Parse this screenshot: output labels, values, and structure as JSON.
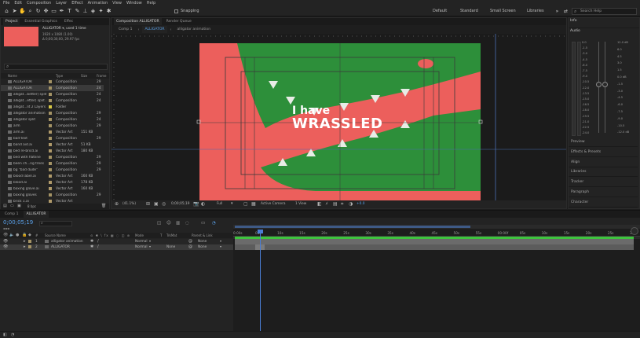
{
  "menu": [
    "File",
    "Edit",
    "Composition",
    "Layer",
    "Effect",
    "Animation",
    "View",
    "Window",
    "Help"
  ],
  "toolbar": {
    "snapping_label": "Snapping",
    "workspaces": [
      "Default",
      "Standard",
      "Small Screen",
      "Libraries"
    ],
    "search_placeholder": "Search Help"
  },
  "project_panel": {
    "tabs": [
      "Project",
      "Essential Graphics",
      "Effec"
    ],
    "selected_name": "ALLIGATOR ▾, used 1 time",
    "selected_info1": "1920 x 1080 (1.00)",
    "selected_info2": "Δ 0;00;30;00, 29.97 fps",
    "columns": {
      "name": "Name",
      "type": "Type",
      "size": "Size",
      "frame": "Frame"
    },
    "rows": [
      {
        "name": "ALLIGATOR",
        "type": "Composition",
        "size": "",
        "frame": "29",
        "label": "#a49365"
      },
      {
        "name": "ALLIGATOR",
        "type": "Composition",
        "size": "",
        "frame": "24",
        "label": "#a49365",
        "selected": true
      },
      {
        "name": "alligat...better) split",
        "type": "Composition",
        "size": "",
        "frame": "24",
        "label": "#a49365"
      },
      {
        "name": "alligat...etter) split 2",
        "type": "Composition",
        "size": "",
        "frame": "24",
        "label": "#a49365"
      },
      {
        "name": "alligat...lit 2 Layers",
        "type": "Folder",
        "size": "",
        "frame": "",
        "label": "#d8c845"
      },
      {
        "name": "alligator animation",
        "type": "Composition",
        "size": "",
        "frame": "29",
        "label": "#a49365"
      },
      {
        "name": "alligator split",
        "type": "Composition",
        "size": "",
        "frame": "24",
        "label": "#a49365"
      },
      {
        "name": "arm",
        "type": "Composition",
        "size": "",
        "frame": "29",
        "label": "#a49365"
      },
      {
        "name": "arm.ai",
        "type": "Vector Art",
        "size": "151 KB",
        "frame": "",
        "label": "#b09a6a"
      },
      {
        "name": "bad text",
        "type": "Composition",
        "size": "",
        "frame": "29",
        "label": "#a49365"
      },
      {
        "name": "band aid.ai",
        "type": "Vector Art",
        "size": "51 KB",
        "frame": "",
        "label": "#b09a6a"
      },
      {
        "name": "bed re-bricd.ai",
        "type": "Vector Art",
        "size": "180 KB",
        "frame": "",
        "label": "#b09a6a"
      },
      {
        "name": "bed with flatline",
        "type": "Composition",
        "size": "",
        "frame": "29",
        "label": "#a49365"
      },
      {
        "name": "been ch...ng trees",
        "type": "Composition",
        "size": "",
        "frame": "29",
        "label": "#a49365"
      },
      {
        "name": "bg \"bad dude\"",
        "type": "Composition",
        "size": "",
        "frame": "29",
        "label": "#a49365"
      },
      {
        "name": "blood label.ai",
        "type": "Vector Art",
        "size": "160 KB",
        "frame": "",
        "label": "#b09a6a"
      },
      {
        "name": "blood.ai",
        "type": "Vector Art",
        "size": "178 KB",
        "frame": "",
        "label": "#b09a6a"
      },
      {
        "name": "boxing glove.ai",
        "type": "Vector Art",
        "size": "160 KB",
        "frame": "",
        "label": "#b09a6a"
      },
      {
        "name": "boxing gloves",
        "type": "Composition",
        "size": "",
        "frame": "29",
        "label": "#a49365"
      },
      {
        "name": "brick 1.ai",
        "type": "Vector Art",
        "size": "",
        "frame": "",
        "label": "#b09a6a"
      }
    ],
    "bpc": "8 bpc"
  },
  "composition": {
    "tabs": [
      "Composition ALLIGATOR",
      "Render Queue"
    ],
    "breadcrumbs": [
      "Comp 1",
      "ALLIGATOR",
      "alligator animation"
    ],
    "headline1": "I have",
    "headline2": "WRASSLED",
    "zoom": "(41.1%)",
    "timecode": "0;00;05;19",
    "resolution": "Full",
    "camera": "Active Camera",
    "views": "1 View",
    "exposure": "+0.0",
    "colors": {
      "bg": "#ec5f5c",
      "green": "#2d8f3a"
    }
  },
  "right_panel": {
    "info_tab": "Info",
    "audio_tab": "Audio",
    "levels_left": [
      "0.0",
      "-1.5",
      "-3.0",
      "-4.5",
      "-6.0",
      "-7.5",
      "-9.0",
      "-10.5",
      "-12.0",
      "-13.5",
      "-15.0",
      "-16.5",
      "-18.0",
      "-19.5",
      "-21.0",
      "-22.5",
      "-24.0"
    ],
    "levels_right": [
      "12.0 dB",
      "6.0",
      "4.5",
      "3.0",
      "1.5",
      "0.0 dB",
      "-1.5",
      "-3.0",
      "-4.5",
      "-6.0",
      "-7.5",
      "-9.0",
      "-10.5",
      "-12.0 dB"
    ],
    "items": [
      "Preview",
      "Effects & Presets",
      "Align",
      "Libraries",
      "Tracker",
      "Paragraph",
      "Character"
    ]
  },
  "timeline": {
    "tabs": [
      "Comp 1",
      "ALLIGATOR"
    ],
    "timecode": "0;00;05;19",
    "col_headers": {
      "source_name": "Source Name",
      "mode": "Mode",
      "t": "T",
      "trkmat": "TrkMat",
      "parent": "Parent & Link"
    },
    "layers": [
      {
        "num": "1",
        "name": "alligator animation",
        "mode": "Normal",
        "trkmat": "",
        "parent": "None"
      },
      {
        "num": "2",
        "name": "ALLIGATOR",
        "mode": "Normal",
        "trkmat": "None",
        "parent": "None"
      }
    ],
    "ruler": [
      "0:00s",
      "05s",
      "10s",
      "15s",
      "20s",
      "25s",
      "30s",
      "35s",
      "40s",
      "45s",
      "50s",
      "55s",
      "00:00f",
      "05s",
      "10s",
      "15s",
      "20s",
      "25s",
      "30s"
    ],
    "footer_toggle": "Toggle Switches / Modes"
  }
}
